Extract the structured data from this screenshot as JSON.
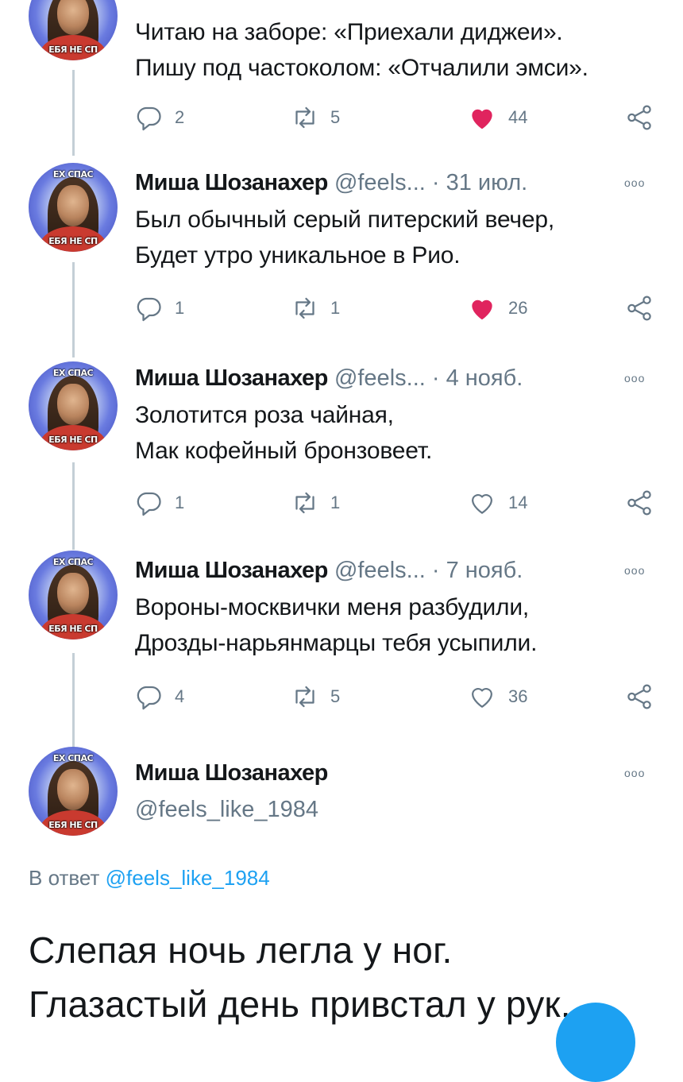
{
  "avatar_caption": {
    "top": "ЕХ СПАС",
    "bottom": "ЕБЯ НЕ СП"
  },
  "tweets": [
    {
      "name": "",
      "handle": "",
      "date": "",
      "lines": [
        "Читаю на заборе: «Приехали диджеи».",
        "Пишу под частоколом: «Отчалили эмси»."
      ],
      "replies": "2",
      "retweets": "5",
      "likes": "44",
      "liked": true
    },
    {
      "name": "Миша Шозанахер",
      "handle": "@feels...",
      "date": "· 31 июл.",
      "lines": [
        "Был обычный серый питерский вечер,",
        "Будет утро уникальное в Рио."
      ],
      "replies": "1",
      "retweets": "1",
      "likes": "26",
      "liked": true
    },
    {
      "name": "Миша Шозанахер",
      "handle": "@feels...",
      "date": "· 4 нояб.",
      "lines": [
        "Золотится роза чайная,",
        "Мак кофейный бронзовеет."
      ],
      "replies": "1",
      "retweets": "1",
      "likes": "14",
      "liked": false
    },
    {
      "name": "Миша Шозанахер",
      "handle": "@feels...",
      "date": "· 7 нояб.",
      "lines": [
        "Вороны-москвички меня разбудили,",
        "Дрозды-нарьянмарцы тебя усыпили."
      ],
      "replies": "4",
      "retweets": "5",
      "likes": "36",
      "liked": false
    }
  ],
  "main_tweet": {
    "name": "Миша Шозанахер",
    "handle": "@feels_like_1984",
    "reply_prefix": "В ответ",
    "reply_mention": "@feels_like_1984",
    "lines": [
      "Слепая ночь легла у ног.",
      "Глазастый день привстал у рук."
    ]
  },
  "colors": {
    "like_active": "#e0245e",
    "icon_gray": "#657786",
    "link": "#1da1f2",
    "thread_line": "#c4cfd6"
  },
  "icons": [
    "reply-icon",
    "retweet-icon",
    "like-icon",
    "share-icon",
    "more-icon"
  ]
}
